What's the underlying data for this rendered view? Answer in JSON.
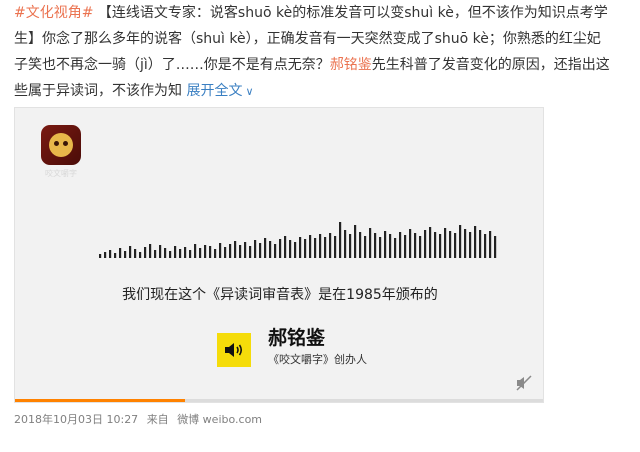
{
  "post": {
    "hashtag": "#文化视角#",
    "title_prefix": " 【连线语文专家：说客",
    "title_pinyin1": "shuō kè",
    "title_mid": "的标准发音可以变",
    "title_pinyin2": "shuì kè",
    "title_suffix": "，但不该作为知识点考学",
    "line2": "生】你念了那么多年的说客（shuì kè），正确发音有一天突然变成了shuō kè；你熟悉的红尘妃",
    "line3": "子笑也不再念一骑（jì）了……你是不是有点无奈？",
    "mention": "郝铭鉴",
    "line3_tail": "先生科普了发音变化的原因，还指出这",
    "line4": "些属于异读词，不该作为知",
    "expand_label": "展开全文",
    "expand_icon": "chevron-down-icon"
  },
  "video": {
    "logo_caption": "咬文嚼字",
    "subtitle": "我们现在这个《异读词审音表》是在1985年颁布的",
    "speaker_name": "郝铭鉴",
    "speaker_role": "《咬文嚼字》创办人",
    "speaker_icon": "speaker-volume-icon",
    "mute_icon": "mute-icon",
    "progress": 0.32,
    "waveform_levels": [
      4,
      6,
      8,
      5,
      10,
      7,
      12,
      9,
      6,
      11,
      14,
      8,
      13,
      10,
      7,
      12,
      9,
      11,
      8,
      14,
      10,
      13,
      12,
      9,
      15,
      11,
      14,
      17,
      13,
      16,
      12,
      18,
      15,
      20,
      17,
      14,
      19,
      22,
      18,
      16,
      21,
      19,
      23,
      20,
      24,
      21,
      25,
      22,
      36,
      28,
      24,
      33,
      26,
      22,
      30,
      25,
      21,
      27,
      24,
      20,
      26,
      23,
      29,
      25,
      22,
      28,
      31,
      26,
      24,
      30,
      27,
      25,
      33,
      29,
      26,
      32,
      28,
      24,
      27,
      22
    ]
  },
  "meta": {
    "timestamp": "2018年10月03日 10:27",
    "source_prefix": "来自",
    "source": "微博 weibo.com"
  },
  "colors": {
    "hashtag": "#eb7350",
    "link": "#3a7fc2",
    "speaker_badge": "#f5dc0a",
    "progress_fill": "#ff8200"
  }
}
